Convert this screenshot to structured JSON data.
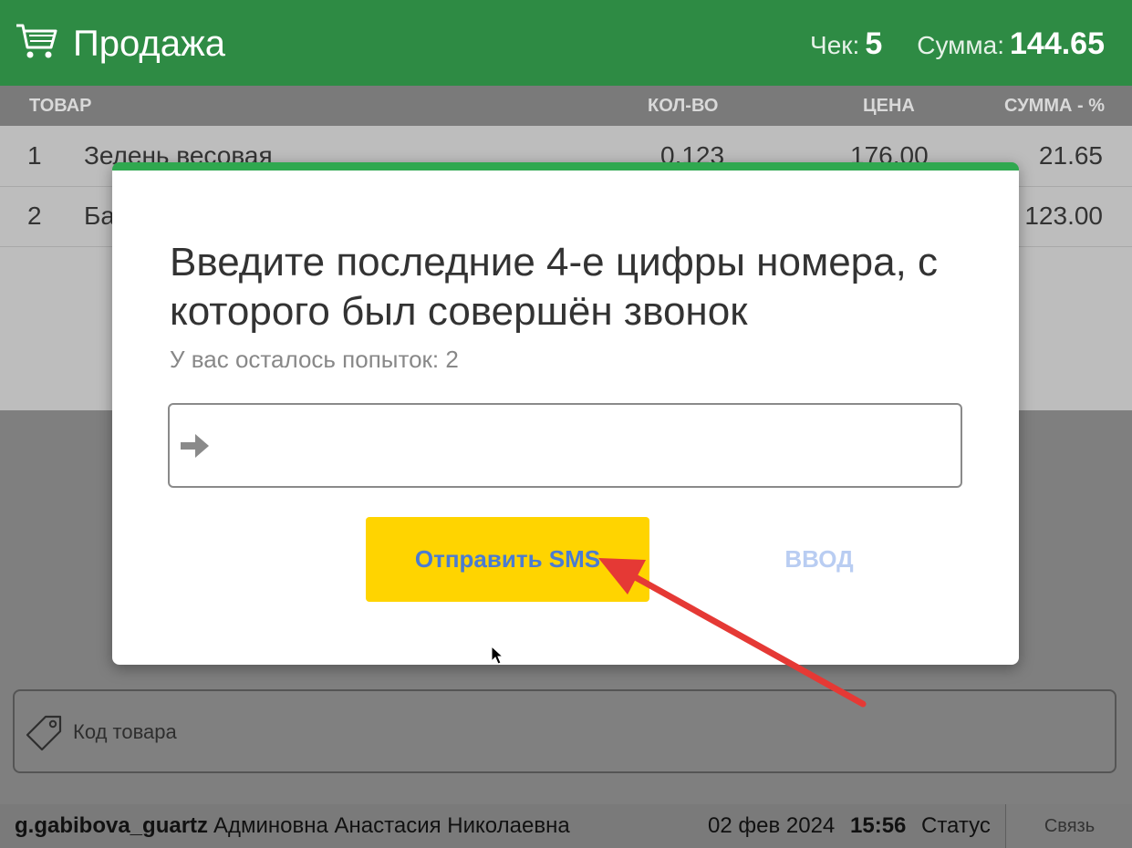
{
  "header": {
    "title": "Продажа",
    "check_label": "Чек:",
    "check_value": "5",
    "sum_label": "Сумма:",
    "sum_value": "144.65",
    "icon": "cart-icon",
    "color": "#2e8b44"
  },
  "table": {
    "columns": [
      "ТОВАР",
      "КОЛ-ВО",
      "ЦЕНА",
      "СУММА - %"
    ],
    "rows": [
      {
        "num": "1",
        "name": "Зелень весовая",
        "qty": "0.123",
        "price": "176.00",
        "sum": "21.65"
      },
      {
        "num": "2",
        "name": "Ба",
        "qty": "",
        "price": "",
        "sum": "123.00"
      }
    ]
  },
  "code_input": {
    "placeholder": "Код товара",
    "icon": "tag-icon"
  },
  "statusbar": {
    "login": "g.gabibova_guartz",
    "user_name": "Админовна Анастасия Николаевна",
    "date": "02 фев 2024",
    "time": "15:56",
    "status": "Статус",
    "link_button": "Связь"
  },
  "dialog": {
    "heading": "Введите последние 4-е цифры номера, с которого был совершён звонок",
    "attempts": "У вас осталось попыток: 2",
    "input_value": "",
    "send_sms_button": "Отправить SMS",
    "enter_button": "ВВОД",
    "accent_color": "#2fa84f",
    "sms_button_color": "#ffd400"
  }
}
